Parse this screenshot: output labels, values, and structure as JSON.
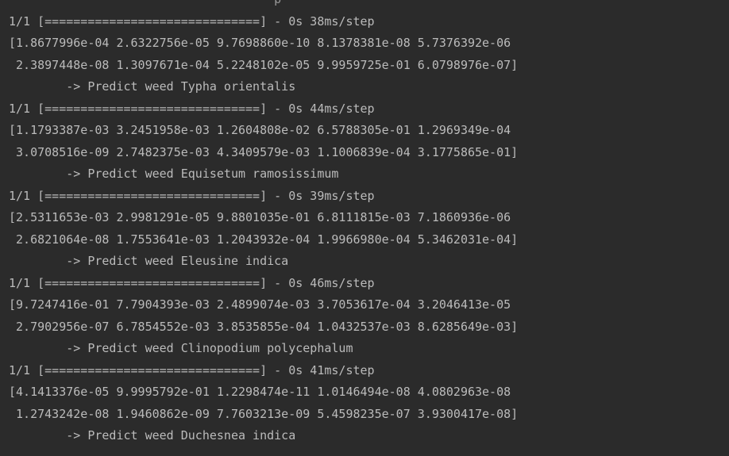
{
  "console": {
    "top_fragment": "                                     p",
    "blocks": [
      {
        "progress": "1/1 [==============================] - 0s 38ms/step",
        "probs_line1": "[1.8677996e-04 2.6322756e-05 9.7698860e-10 8.1378381e-08 5.7376392e-06",
        "probs_line2": " 2.3897448e-08 1.3097671e-04 5.2248102e-05 9.9959725e-01 6.0798976e-07]",
        "prediction": "        -> Predict weed Typha orientalis"
      },
      {
        "progress": "1/1 [==============================] - 0s 44ms/step",
        "probs_line1": "[1.1793387e-03 3.2451958e-03 1.2604808e-02 6.5788305e-01 1.2969349e-04",
        "probs_line2": " 3.0708516e-09 2.7482375e-03 4.3409579e-03 1.1006839e-04 3.1775865e-01]",
        "prediction": "        -> Predict weed Equisetum ramosissimum"
      },
      {
        "progress": "1/1 [==============================] - 0s 39ms/step",
        "probs_line1": "[2.5311653e-03 2.9981291e-05 9.8801035e-01 6.8111815e-03 7.1860936e-06",
        "probs_line2": " 2.6821064e-08 1.7553641e-03 1.2043932e-04 1.9966980e-04 5.3462031e-04]",
        "prediction": "        -> Predict weed Eleusine indica"
      },
      {
        "progress": "1/1 [==============================] - 0s 46ms/step",
        "probs_line1": "[9.7247416e-01 7.7904393e-03 2.4899074e-03 3.7053617e-04 3.2046413e-05",
        "probs_line2": " 2.7902956e-07 6.7854552e-03 3.8535855e-04 1.0432537e-03 8.6285649e-03]",
        "prediction": "        -> Predict weed Clinopodium polycephalum"
      },
      {
        "progress": "1/1 [==============================] - 0s 41ms/step",
        "probs_line1": "[4.1413376e-05 9.9995792e-01 1.2298474e-11 1.0146494e-08 4.0802963e-08",
        "probs_line2": " 1.2743242e-08 1.9460862e-09 7.7603213e-09 5.4598235e-07 3.9300417e-08]",
        "prediction": "        -> Predict weed Duchesnea indica"
      }
    ]
  }
}
